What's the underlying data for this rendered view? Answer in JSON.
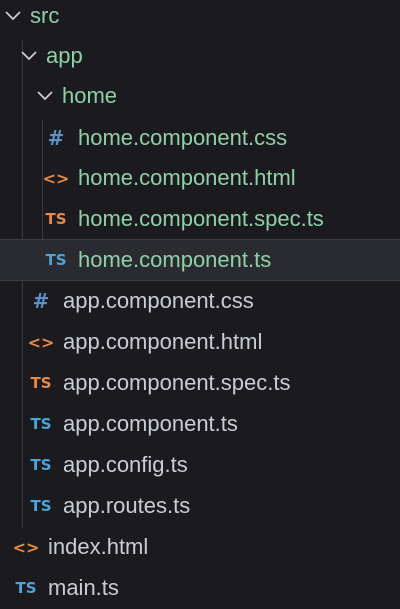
{
  "explorer": {
    "folders": {
      "src": "src",
      "app": "app",
      "home": "home"
    },
    "home_files": [
      {
        "name": "home.component.css",
        "icon": "hash-icon",
        "icon_text": "#"
      },
      {
        "name": "home.component.html",
        "icon": "code-icon",
        "icon_text": "<>"
      },
      {
        "name": "home.component.spec.ts",
        "icon": "ts-icon",
        "icon_text": "TS"
      },
      {
        "name": "home.component.ts",
        "icon": "ts-icon",
        "icon_text": "TS",
        "selected": true
      }
    ],
    "app_files": [
      {
        "name": "app.component.css",
        "icon": "hash-icon",
        "icon_text": "#"
      },
      {
        "name": "app.component.html",
        "icon": "code-icon",
        "icon_text": "<>"
      },
      {
        "name": "app.component.spec.ts",
        "icon": "ts-icon",
        "icon_text": "TS"
      },
      {
        "name": "app.component.ts",
        "icon": "ts-icon",
        "icon_text": "TS"
      },
      {
        "name": "app.config.ts",
        "icon": "ts-icon",
        "icon_text": "TS"
      },
      {
        "name": "app.routes.ts",
        "icon": "ts-icon",
        "icon_text": "TS"
      }
    ],
    "src_files": [
      {
        "name": "index.html",
        "icon": "code-icon",
        "icon_text": "<>"
      },
      {
        "name": "main.ts",
        "icon": "ts-icon",
        "icon_text": "TS"
      }
    ]
  },
  "colors": {
    "background": "#1b1b1f",
    "folder_text": "#8fd0a8",
    "file_text": "#c9ccd6",
    "ts_blue": "#4ea3d8",
    "spec_orange": "#e8894a",
    "selection": "#2a2b30"
  }
}
